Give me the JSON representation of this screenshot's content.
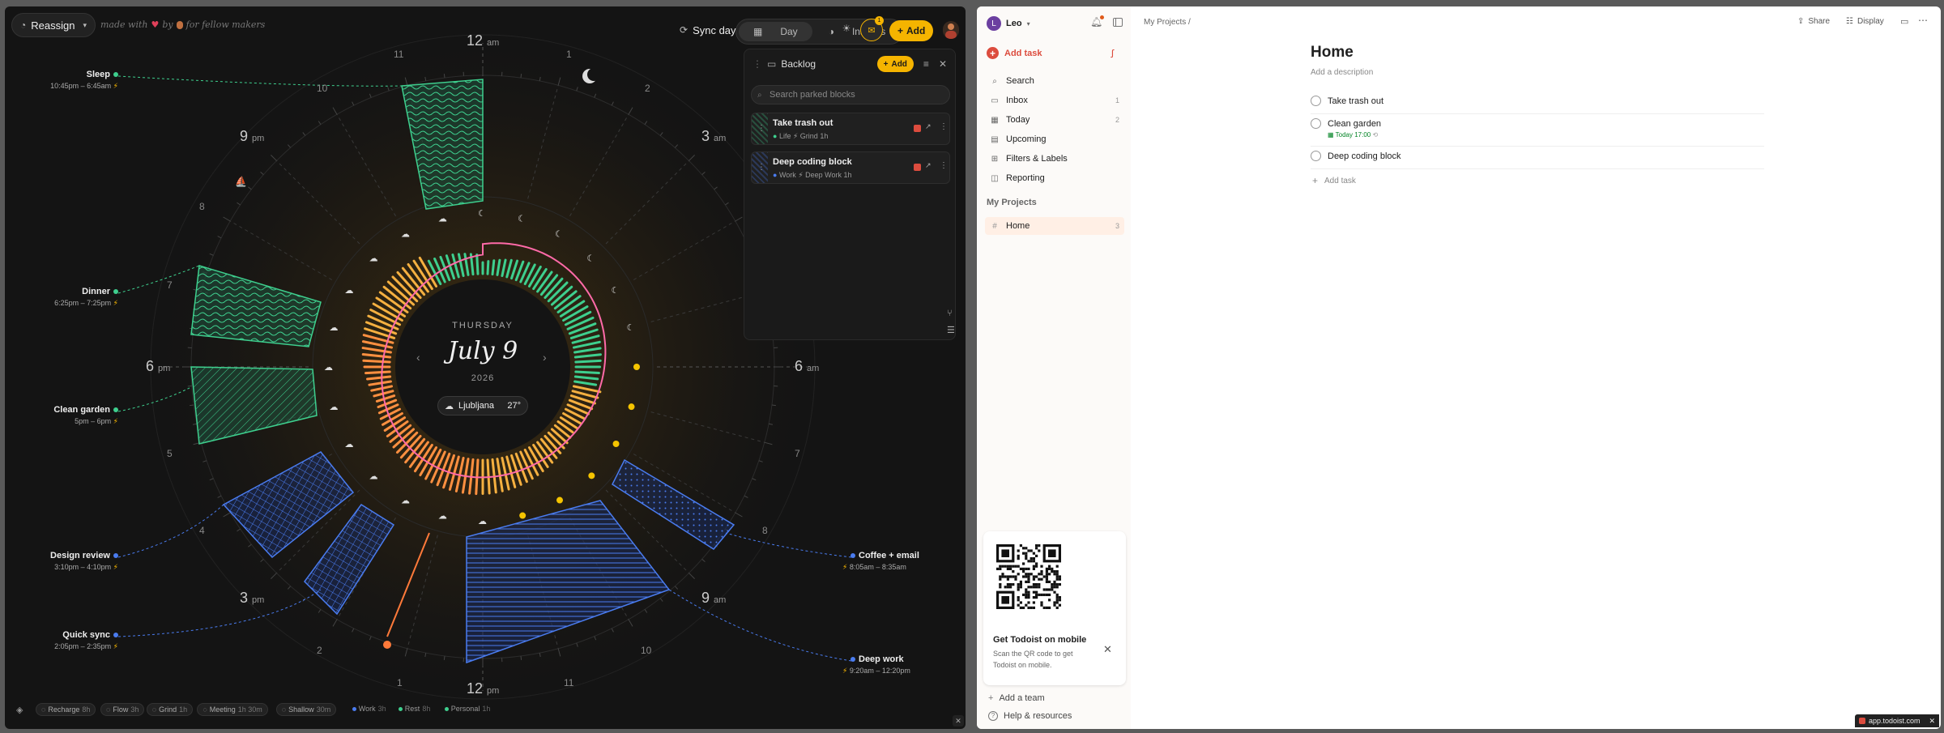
{
  "left": {
    "reassign": "Reassign",
    "made_with": "made with",
    "by": "by",
    "for_makers": "for fellow makers",
    "sync_day": "Sync day",
    "tab_day": "Day",
    "tab_insights": "Insights",
    "add": "Add",
    "badge": "1",
    "center": {
      "weekday": "THURSDAY",
      "date": "July 9",
      "year": "2026",
      "city": "Ljubljana",
      "temp": "27°"
    },
    "hours": {
      "h12am": "12",
      "am": "am",
      "h3am": "3",
      "h6am": "6",
      "h9am": "9",
      "h12pm": "12",
      "pm": "pm",
      "h3pm": "3",
      "h6pm": "6",
      "h9pm": "9",
      "s11": "11",
      "s1": "1",
      "s2": "2",
      "s4": "4",
      "s5": "5",
      "s7": "7",
      "s8": "8",
      "s10": "10"
    },
    "events": [
      {
        "name": "Sleep",
        "time": "10:45pm – 6:45am",
        "color": "#3ecf8e"
      },
      {
        "name": "Dinner",
        "time": "6:25pm – 7:25pm",
        "color": "#3ecf8e"
      },
      {
        "name": "Clean garden",
        "time": "5pm – 6pm",
        "color": "#3ecf8e"
      },
      {
        "name": "Design review",
        "time": "3:10pm – 4:10pm",
        "color": "#4a7cf0"
      },
      {
        "name": "Quick sync",
        "time": "2:05pm – 2:35pm",
        "color": "#4a7cf0"
      },
      {
        "name": "Coffee + email",
        "time": "8:05am – 8:35am",
        "color": "#4a7cf0"
      },
      {
        "name": "Deep work",
        "time": "9:20am – 12:20pm",
        "color": "#4a7cf0"
      }
    ],
    "backlog": {
      "title": "Backlog",
      "add": "Add",
      "search_placeholder": "Search parked blocks",
      "items": [
        {
          "title": "Take trash out",
          "cat": "Life",
          "energy": "Grind",
          "dur": "1h"
        },
        {
          "title": "Deep coding block",
          "cat": "Work",
          "energy": "Deep Work",
          "dur": "1h"
        }
      ]
    },
    "chips": [
      {
        "label": "Recharge",
        "dur": "8h"
      },
      {
        "label": "Flow",
        "dur": "3h"
      },
      {
        "label": "Grind",
        "dur": "1h"
      },
      {
        "label": "Meeting",
        "dur": "1h 30m"
      },
      {
        "label": "Shallow",
        "dur": "30m"
      }
    ],
    "legend": [
      {
        "label": "Work",
        "dur": "3h",
        "color": "#4a7cf0"
      },
      {
        "label": "Rest",
        "dur": "8h",
        "color": "#3ecf8e"
      },
      {
        "label": "Personal",
        "dur": "1h",
        "color": "#3ecf8e"
      }
    ]
  },
  "right": {
    "user": "Leo",
    "avatar": "L",
    "add_task": "Add task",
    "nav": [
      {
        "label": "Search",
        "icon": "search-icon",
        "count": ""
      },
      {
        "label": "Inbox",
        "icon": "inbox-icon",
        "count": "1"
      },
      {
        "label": "Today",
        "icon": "today-icon",
        "count": "2"
      },
      {
        "label": "Upcoming",
        "icon": "upcoming-icon",
        "count": ""
      },
      {
        "label": "Filters & Labels",
        "icon": "filter-icon",
        "count": ""
      },
      {
        "label": "Reporting",
        "icon": "reporting-icon",
        "count": ""
      }
    ],
    "my_projects": "My Projects",
    "project": {
      "label": "Home",
      "count": "3"
    },
    "breadcrumb": "My Projects /",
    "share": "Share",
    "display": "Display",
    "title": "Home",
    "description": "Add a description",
    "tasks": [
      {
        "title": "Take trash out",
        "due": ""
      },
      {
        "title": "Clean garden",
        "due": "Today 17:00"
      },
      {
        "title": "Deep coding block",
        "due": ""
      }
    ],
    "add_task_inline": "Add task",
    "promo": {
      "title": "Get Todoist on mobile",
      "body": "Scan the QR code to get Todoist on mobile."
    },
    "add_team": "Add a team",
    "help": "Help & resources",
    "app_badge": "app.todoist.com"
  }
}
